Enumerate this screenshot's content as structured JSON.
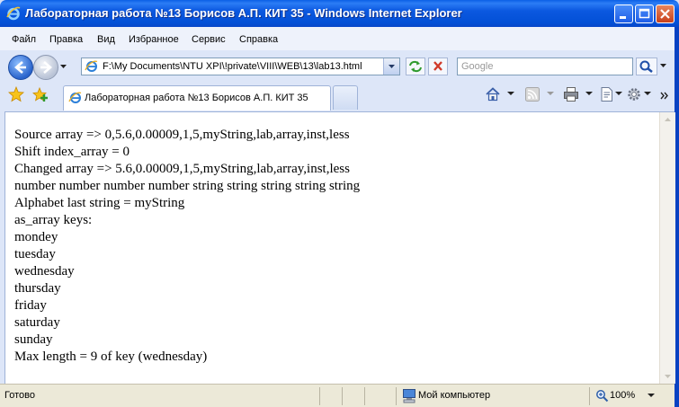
{
  "window": {
    "title": "Лабораторная работа №13 Борисов А.П. КИТ 35 - Windows Internet Explorer"
  },
  "menu": {
    "items": [
      "Файл",
      "Правка",
      "Вид",
      "Избранное",
      "Сервис",
      "Справка"
    ]
  },
  "address": {
    "url": "F:\\My Documents\\NTU XPI\\!private\\VIII\\WEB\\13\\lab13.html"
  },
  "search": {
    "placeholder": "Google"
  },
  "tab": {
    "label": "Лабораторная работа №13 Борисов А.П. КИТ 35"
  },
  "page": {
    "lines": [
      "Source array => 0,5.6,0.00009,1,5,myString,lab,array,inst,less",
      "Shift index_array = 0",
      "Changed array => 5.6,0.00009,1,5,myString,lab,array,inst,less",
      "number number number number string string string string string",
      "Alphabet last string = myString",
      "as_array keys:",
      "mondey",
      "tuesday",
      "wednesday",
      "thursday",
      "friday",
      "saturday",
      "sunday",
      "Max length = 9 of key (wednesday)"
    ]
  },
  "status": {
    "text": "Готово",
    "zone": "Мой компьютер",
    "zoom": "100%"
  },
  "colors": {
    "titlebar": "#0350d6",
    "toolbar": "#dde6f8",
    "statusbar": "#ece9d8"
  }
}
